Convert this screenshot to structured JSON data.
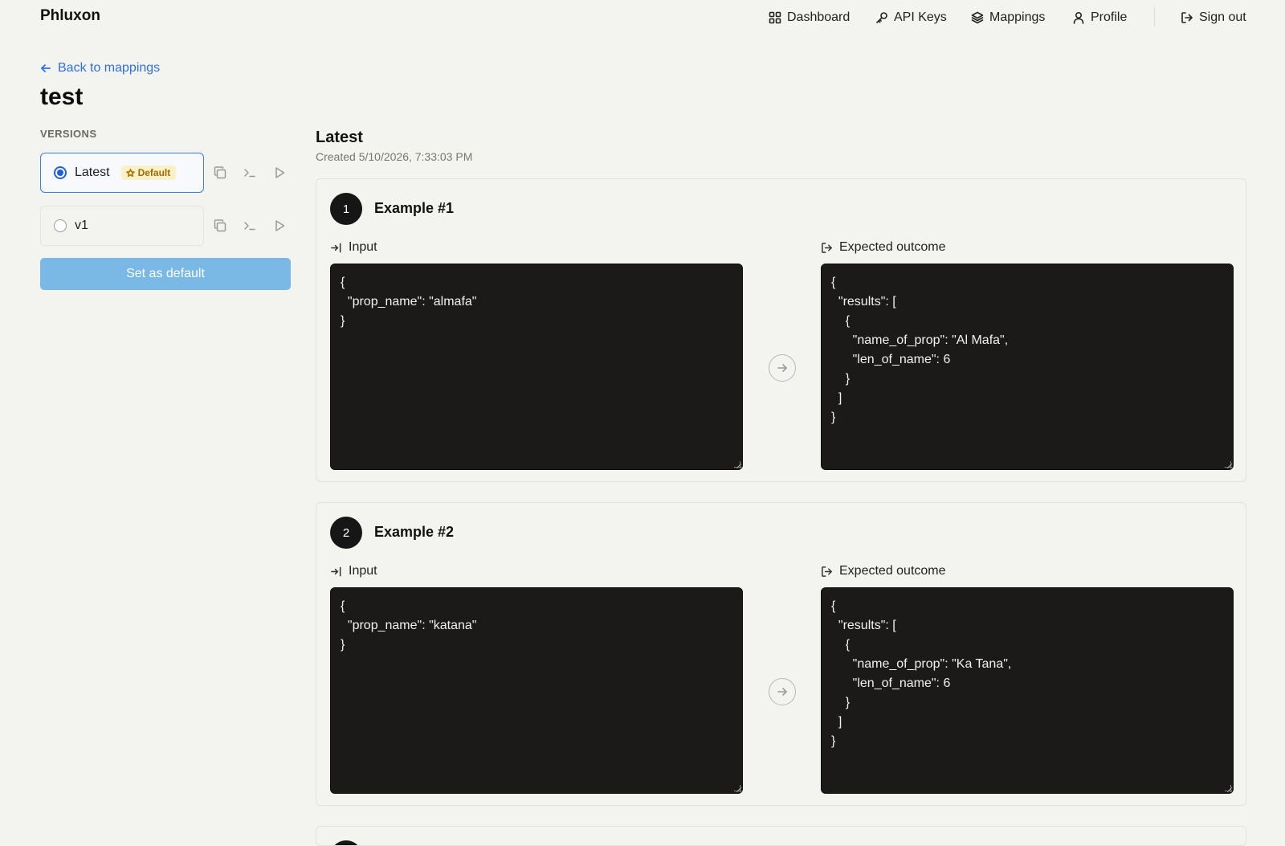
{
  "app": {
    "brand": "Phluxon"
  },
  "nav": {
    "items": [
      {
        "label": "Dashboard",
        "icon": "dashboard-icon"
      },
      {
        "label": "API Keys",
        "icon": "key-icon"
      },
      {
        "label": "Mappings",
        "icon": "layers-icon"
      },
      {
        "label": "Profile",
        "icon": "user-icon"
      }
    ],
    "sign_out": "Sign out"
  },
  "back_link": "Back to mappings",
  "page_title": "test",
  "versions": {
    "label": "VERSIONS",
    "items": [
      {
        "name": "Latest",
        "selected": true,
        "badge": "Default"
      },
      {
        "name": "v1",
        "selected": false,
        "badge": ""
      }
    ],
    "set_default_label": "Set as default"
  },
  "detail": {
    "title": "Latest",
    "created": "Created 5/10/2026, 7:33:03 PM",
    "input_label": "Input",
    "outcome_label": "Expected outcome",
    "examples": [
      {
        "number": "1",
        "title": "Example #1",
        "input": "{\n  \"prop_name\": \"almafa\"\n}",
        "outcome": "{\n  \"results\": [\n    {\n      \"name_of_prop\": \"Al Mafa\",\n      \"len_of_name\": 6\n    }\n  ]\n}"
      },
      {
        "number": "2",
        "title": "Example #2",
        "input": "{\n  \"prop_name\": \"katana\"\n}",
        "outcome": "{\n  \"results\": [\n    {\n      \"name_of_prop\": \"Ka Tana\",\n      \"len_of_name\": 6\n    }\n  ]\n}"
      }
    ]
  },
  "colors": {
    "background": "#f3f3ef",
    "accent": "#1d5fe0",
    "link": "#2f6fde",
    "button_disabled": "#7ab8e6",
    "badge_bg": "#fbf1c9",
    "code_bg": "#1b1a19"
  }
}
